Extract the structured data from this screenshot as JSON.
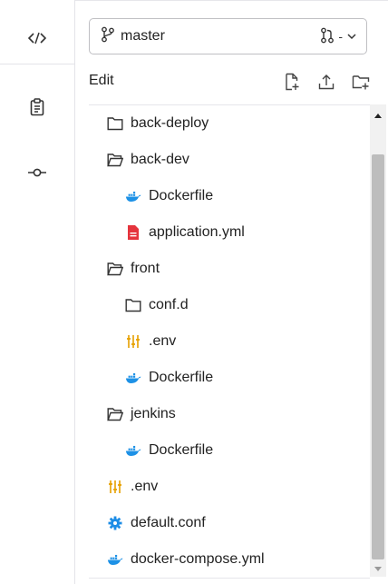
{
  "rail": {
    "items": [
      {
        "icon": "code-icon"
      },
      {
        "icon": "clipboard-icon"
      },
      {
        "icon": "commit-icon"
      }
    ]
  },
  "branch": {
    "icon": "branch-icon",
    "name": "master",
    "mr_count": "-",
    "mr_icon": "merge-request-icon"
  },
  "toolbar": {
    "edit_label": "Edit",
    "actions": [
      "new-file-icon",
      "upload-icon",
      "new-folder-icon"
    ]
  },
  "tree": {
    "items": [
      {
        "name": "back-deploy",
        "type": "folder-closed",
        "depth": 0
      },
      {
        "name": "back-dev",
        "type": "folder-open",
        "depth": 0
      },
      {
        "name": "Dockerfile",
        "type": "docker",
        "depth": 1
      },
      {
        "name": "application.yml",
        "type": "file-red",
        "depth": 1
      },
      {
        "name": "front",
        "type": "folder-open",
        "depth": 0
      },
      {
        "name": "conf.d",
        "type": "folder-closed",
        "depth": 1
      },
      {
        "name": ".env",
        "type": "env",
        "depth": 1
      },
      {
        "name": "Dockerfile",
        "type": "docker",
        "depth": 1
      },
      {
        "name": "jenkins",
        "type": "folder-open",
        "depth": 0
      },
      {
        "name": "Dockerfile",
        "type": "docker",
        "depth": 1
      },
      {
        "name": ".env",
        "type": "env",
        "depth": 0
      },
      {
        "name": "default.conf",
        "type": "gear",
        "depth": 0
      },
      {
        "name": "docker-compose.yml",
        "type": "docker",
        "depth": 0
      }
    ]
  },
  "colors": {
    "docker": "#1d91e6",
    "red_file": "#e5343d",
    "env": "#e6a000",
    "gear": "#1d8de6"
  }
}
